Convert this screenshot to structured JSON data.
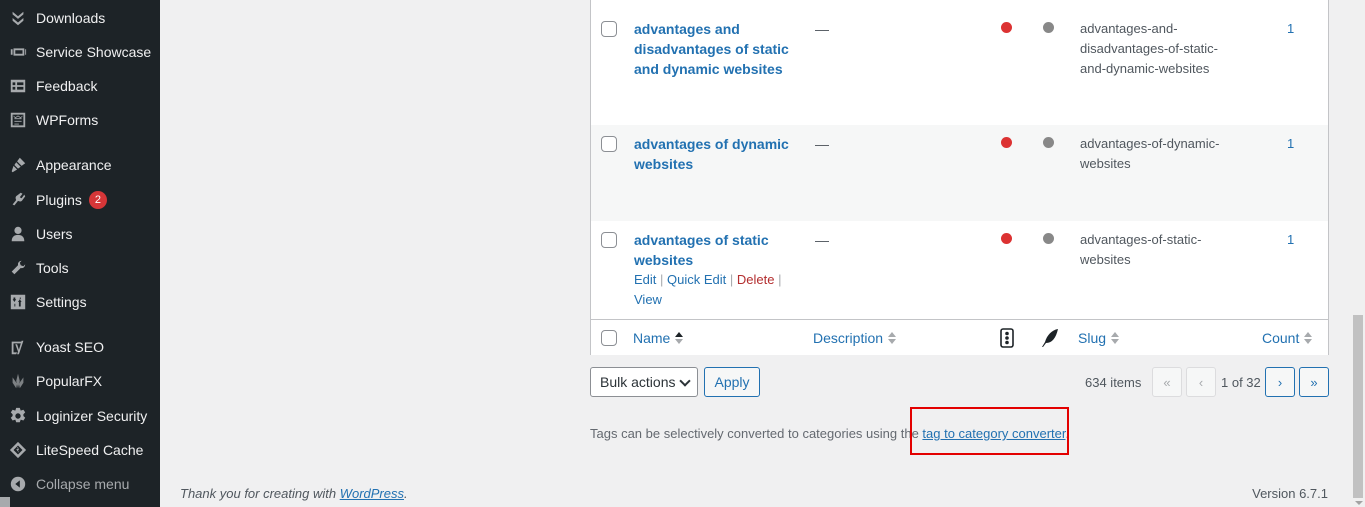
{
  "sidebar": {
    "items": [
      {
        "label": "Downloads",
        "icon": "downloads-icon"
      },
      {
        "label": "Service Showcase",
        "icon": "service-showcase-icon"
      },
      {
        "label": "Feedback",
        "icon": "feedback-icon"
      },
      {
        "label": "WPForms",
        "icon": "wpforms-icon"
      },
      {
        "label": "Appearance",
        "icon": "paintbrush-icon"
      },
      {
        "label": "Plugins",
        "icon": "plugin-icon",
        "badge": "2"
      },
      {
        "label": "Users",
        "icon": "users-icon"
      },
      {
        "label": "Tools",
        "icon": "wrench-icon"
      },
      {
        "label": "Settings",
        "icon": "settings-sliders-icon"
      },
      {
        "label": "Yoast SEO",
        "icon": "yoast-icon"
      },
      {
        "label": "PopularFX",
        "icon": "popularfx-icon"
      },
      {
        "label": "Loginizer Security",
        "icon": "gear-icon"
      },
      {
        "label": "LiteSpeed Cache",
        "icon": "litespeed-icon"
      }
    ],
    "collapse_label": "Collapse menu"
  },
  "table": {
    "rows": [
      {
        "name": "advantages and disadvantages of static and dynamic websites",
        "description": "—",
        "seo_status": "red",
        "readability_status": "gray",
        "slug": "advantages-and-disadvantages-of-static-and-dynamic-websites",
        "count": "1"
      },
      {
        "name": "advantages of dynamic websites",
        "description": "—",
        "seo_status": "red",
        "readability_status": "gray",
        "slug": "advantages-of-dynamic-websites",
        "count": "1"
      },
      {
        "name": "advantages of static websites",
        "description": "—",
        "seo_status": "red",
        "readability_status": "gray",
        "slug": "advantages-of-static-websites",
        "count": "1",
        "row_actions": {
          "edit": "Edit",
          "quick_edit": "Quick Edit",
          "delete": "Delete",
          "view": "View"
        }
      }
    ],
    "footer_columns": {
      "name": "Name",
      "description": "Description",
      "slug": "Slug",
      "count": "Count"
    }
  },
  "tablenav": {
    "bulk_actions_label": "Bulk actions",
    "apply_label": "Apply",
    "items_count": "634 items",
    "first_page": "«",
    "prev_page": "‹",
    "page_of": "1 of 32",
    "next_page": "›",
    "last_page": "»"
  },
  "converter_note": {
    "text": "Tags can be selectively converted to categories using the ",
    "link": "tag to category converter",
    "suffix": "."
  },
  "footer": {
    "thanks_prefix": "Thank you for creating with ",
    "thanks_link": "WordPress",
    "thanks_suffix": ".",
    "version": "Version 6.7.1"
  }
}
